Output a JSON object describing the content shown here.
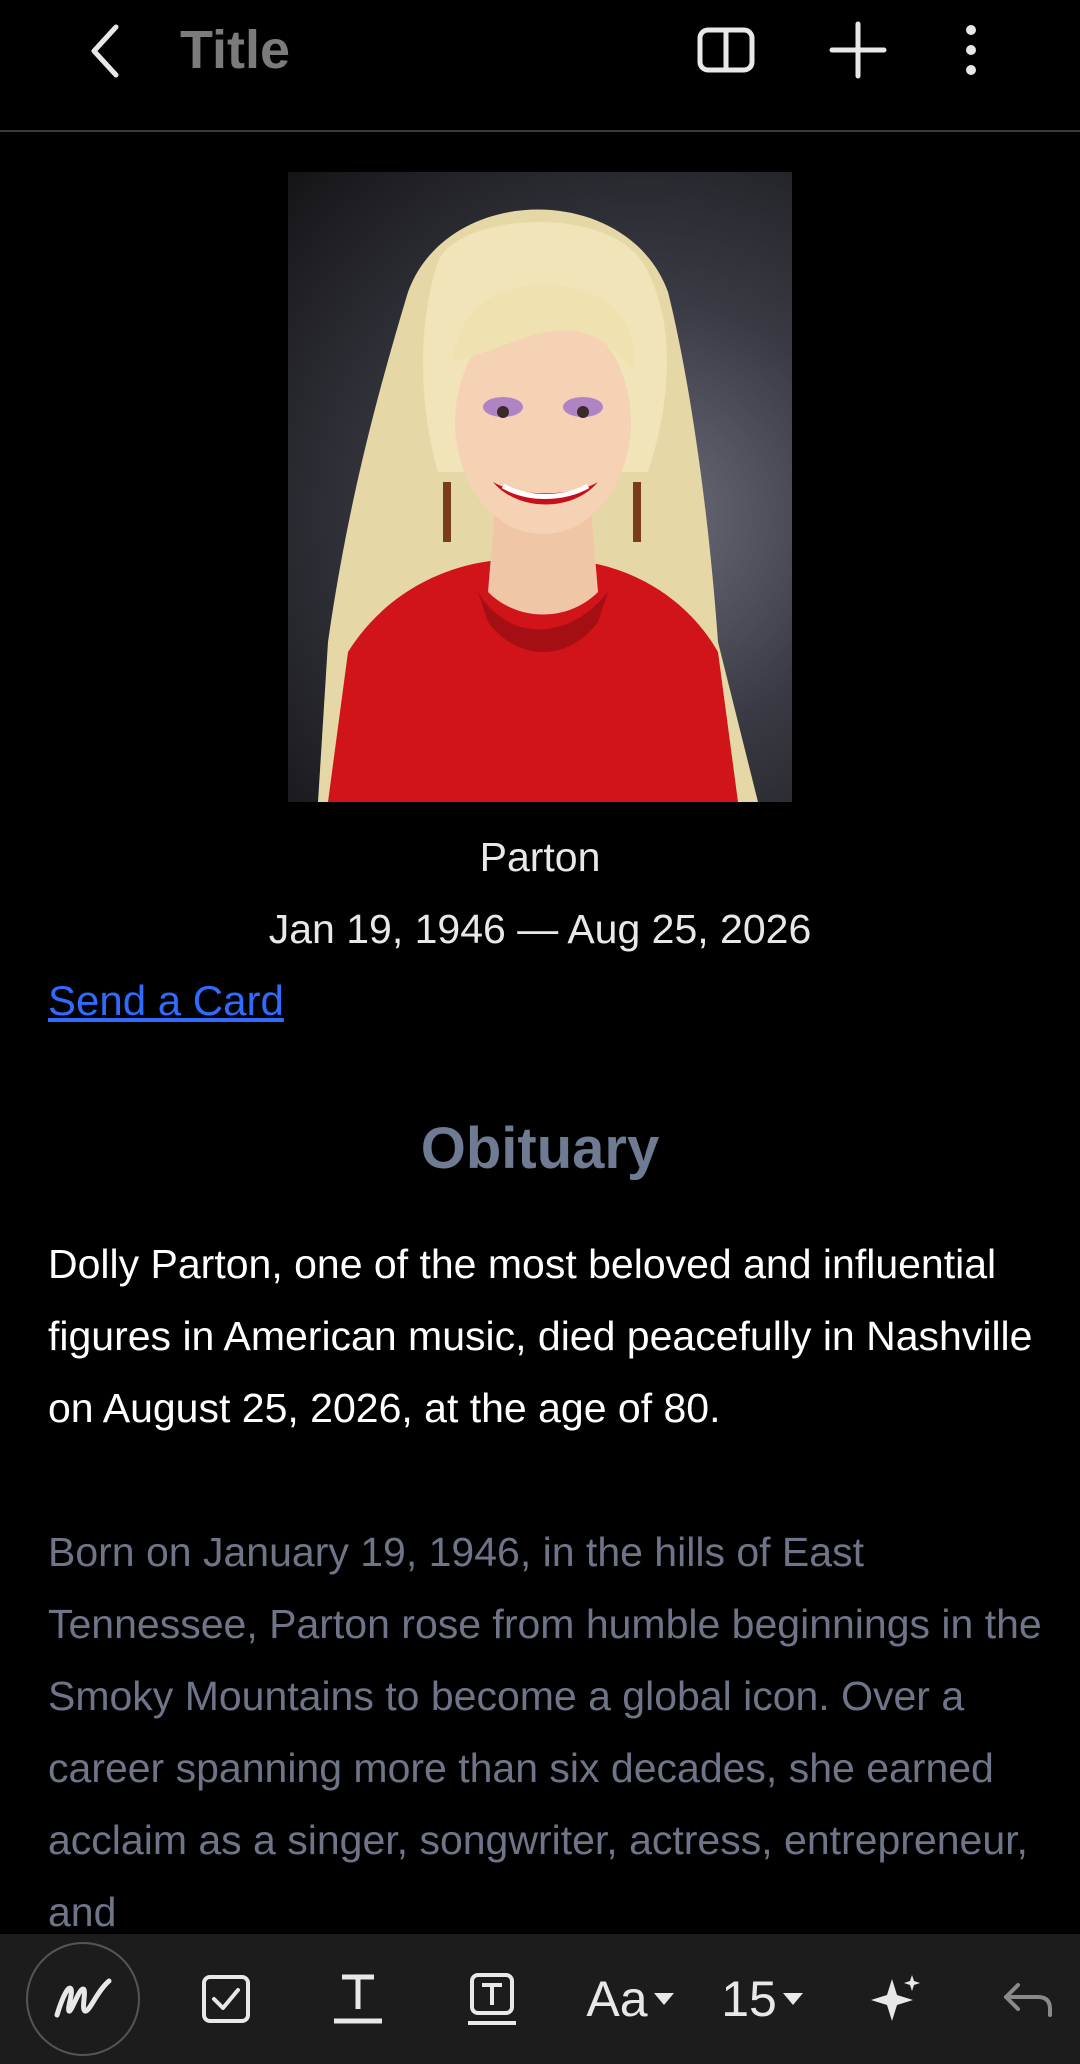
{
  "header": {
    "title": "Title"
  },
  "note": {
    "photo_icon": "portrait-photo",
    "caption_name": "Parton",
    "caption_dates": "Jan 19, 1946 — Aug 25, 2026",
    "link_text": "Send a Card",
    "heading": "Obituary",
    "paragraph1": "Dolly Parton, one of the most beloved and influential figures in American music, died peacefully in Nashville on August 25, 2026, at the age of 80.",
    "paragraph2": "Born on January 19, 1946, in the hills of East Tennessee, Parton rose from humble beginnings in the Smoky Mountains to become a global icon. Over a career spanning more than six decades, she earned acclaim as a singer, songwriter, actress, entrepreneur, and"
  },
  "toolbar": {
    "font_label": "Aa",
    "size_value": "15"
  },
  "colors": {
    "background": "#000000",
    "toolbar": "#1c1c1c",
    "link": "#2f6bff",
    "heading": "#6e7b92",
    "muted_text": "#6f7589"
  }
}
